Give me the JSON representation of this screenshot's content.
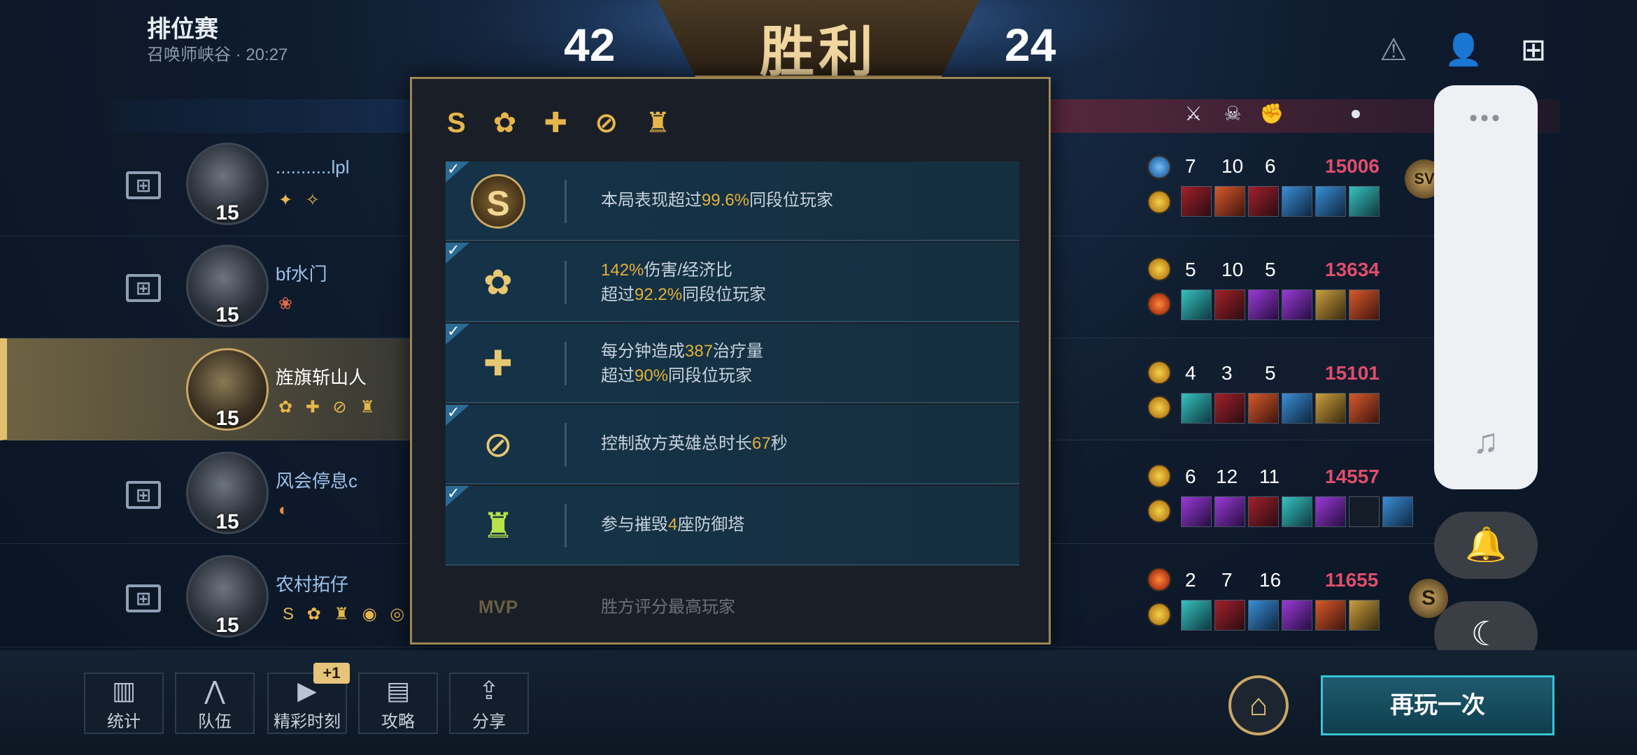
{
  "header": {
    "title": "排位赛",
    "subtitle": "召唤师峡谷 · 20:27",
    "result": "胜利",
    "score_left": "42",
    "score_right": "24",
    "icons": [
      "warning-icon",
      "add-friend-icon",
      "report-icon"
    ]
  },
  "stat_headers": [
    "crossed-swords-icon",
    "skull-icon",
    "fist-icon",
    "coin-icon"
  ],
  "players": [
    {
      "name": "...........lpl",
      "level": "15",
      "badges": "✦ ✧",
      "kills": "7",
      "deaths": "10",
      "assists": "6",
      "gold": "15006"
    },
    {
      "name": "bf水门",
      "level": "15",
      "badges": "❀",
      "kills": "5",
      "deaths": "10",
      "assists": "5",
      "gold": "13634"
    },
    {
      "name": "旌旗斩山人",
      "level": "15",
      "badges": "✿ ✚ ⊘ ♜",
      "kills": "4",
      "deaths": "3",
      "assists": "5",
      "gold": "15101"
    },
    {
      "name": "风会停息c",
      "level": "15",
      "badges": "◐",
      "kills": "6",
      "deaths": "12",
      "assists": "11",
      "gold": "14557"
    },
    {
      "name": "农村拓仔",
      "level": "15",
      "badges": "S ✿ ♜ ◉ ◎",
      "kills": "2",
      "deaths": "7",
      "assists": "16",
      "gold": "11655"
    }
  ],
  "popup": {
    "badges": "S ✿ ✚ ⊘ ♜",
    "items": [
      {
        "icon": "S",
        "line1_pre": "本局表现超过",
        "line1_num": "99.6%",
        "line1_post": "同段位玩家",
        "line2_pre": "",
        "line2_num": "",
        "line2_post": ""
      },
      {
        "icon": "✿",
        "line1_pre": "",
        "line1_num": "142%",
        "line1_post": "伤害/经济比",
        "line2_pre": "超过",
        "line2_num": "92.2%",
        "line2_post": "同段位玩家"
      },
      {
        "icon": "✚",
        "line1_pre": "每分钟造成",
        "line1_num": "387",
        "line1_post": "治疗量",
        "line2_pre": "超过",
        "line2_num": "90%",
        "line2_post": "同段位玩家"
      },
      {
        "icon": "⊘",
        "line1_pre": "控制敌方英雄总时长",
        "line1_num": "67",
        "line1_post": "秒",
        "line2_pre": "",
        "line2_num": "",
        "line2_post": ""
      },
      {
        "icon": "♜",
        "line1_pre": "参与摧毁",
        "line1_num": "4",
        "line1_post": "座防御塔",
        "line2_pre": "",
        "line2_num": "",
        "line2_post": ""
      }
    ],
    "mvp_icon": "MVP",
    "mvp_text": "胜方评分最高玩家"
  },
  "side_panel": {
    "dots": "•••",
    "music": "♫",
    "bell": "🔔",
    "moon": "☾"
  },
  "toolbar": [
    {
      "icon": "▥",
      "label": "统计"
    },
    {
      "icon": "⋀",
      "label": "队伍"
    },
    {
      "icon": "▶",
      "label": "精彩时刻"
    },
    {
      "icon": "▤",
      "label": "攻略"
    },
    {
      "icon": "⇪",
      "label": "分享"
    }
  ],
  "toolbar_badge": "+1",
  "home_icon": "⌂",
  "play_again": "再玩一次",
  "colors": {
    "accent_gold": "#e2b13a",
    "enemy_gold": "#e04e6c",
    "border_gold": "#9c8653",
    "play_button": "#38c3d6"
  }
}
